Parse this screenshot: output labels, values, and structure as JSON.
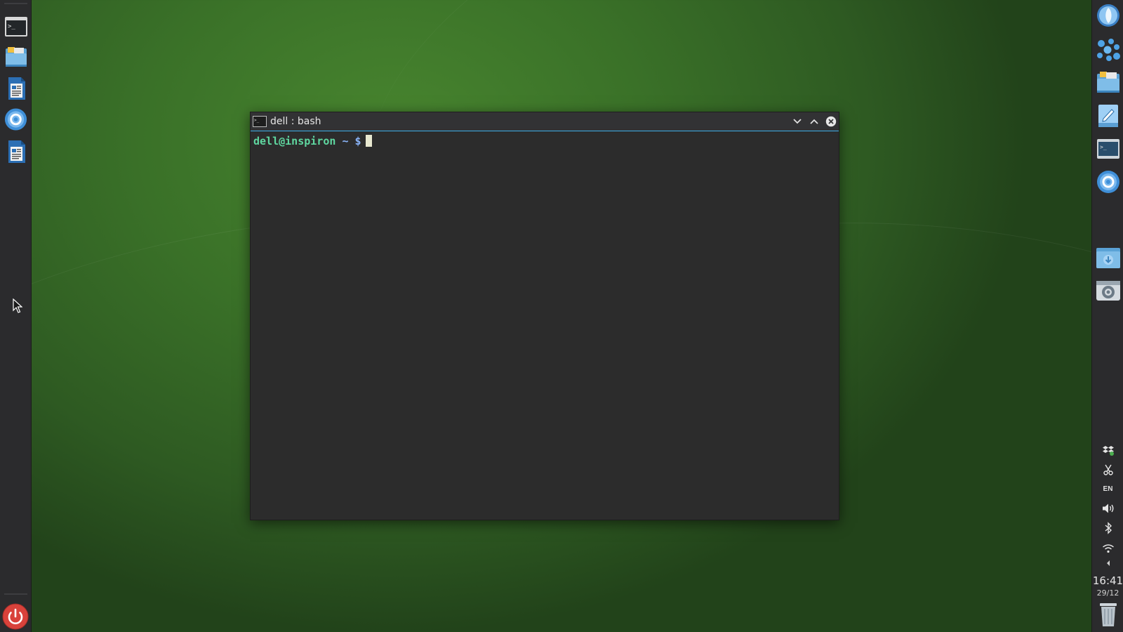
{
  "desktop": {
    "background_color": "#3a7128"
  },
  "left_dock": {
    "items": [
      {
        "name": "terminal-launcher",
        "icon": "terminal-icon"
      },
      {
        "name": "file-manager-launcher",
        "icon": "folder-icon"
      },
      {
        "name": "document-editor-launcher",
        "icon": "document-icon"
      },
      {
        "name": "browser-launcher",
        "icon": "browser-icon"
      },
      {
        "name": "document-viewer-launcher",
        "icon": "document-icon"
      }
    ],
    "power_icon": "power-icon"
  },
  "right_panel": {
    "launchers": [
      {
        "icon": "browser-icon"
      },
      {
        "icon": "apps-grid-icon"
      },
      {
        "icon": "folder-icon"
      },
      {
        "icon": "text-editor-icon"
      },
      {
        "icon": "terminal-icon"
      },
      {
        "icon": "browser-icon"
      },
      {
        "icon": "downloads-folder-icon"
      },
      {
        "icon": "system-settings-icon"
      }
    ],
    "tray": {
      "keyboard_layout": "EN"
    },
    "clock": {
      "time": "16:41",
      "date": "29/12"
    }
  },
  "terminal": {
    "title": "dell : bash",
    "prompt": {
      "user_host": "dell@inspiron",
      "path": "~ $"
    }
  }
}
